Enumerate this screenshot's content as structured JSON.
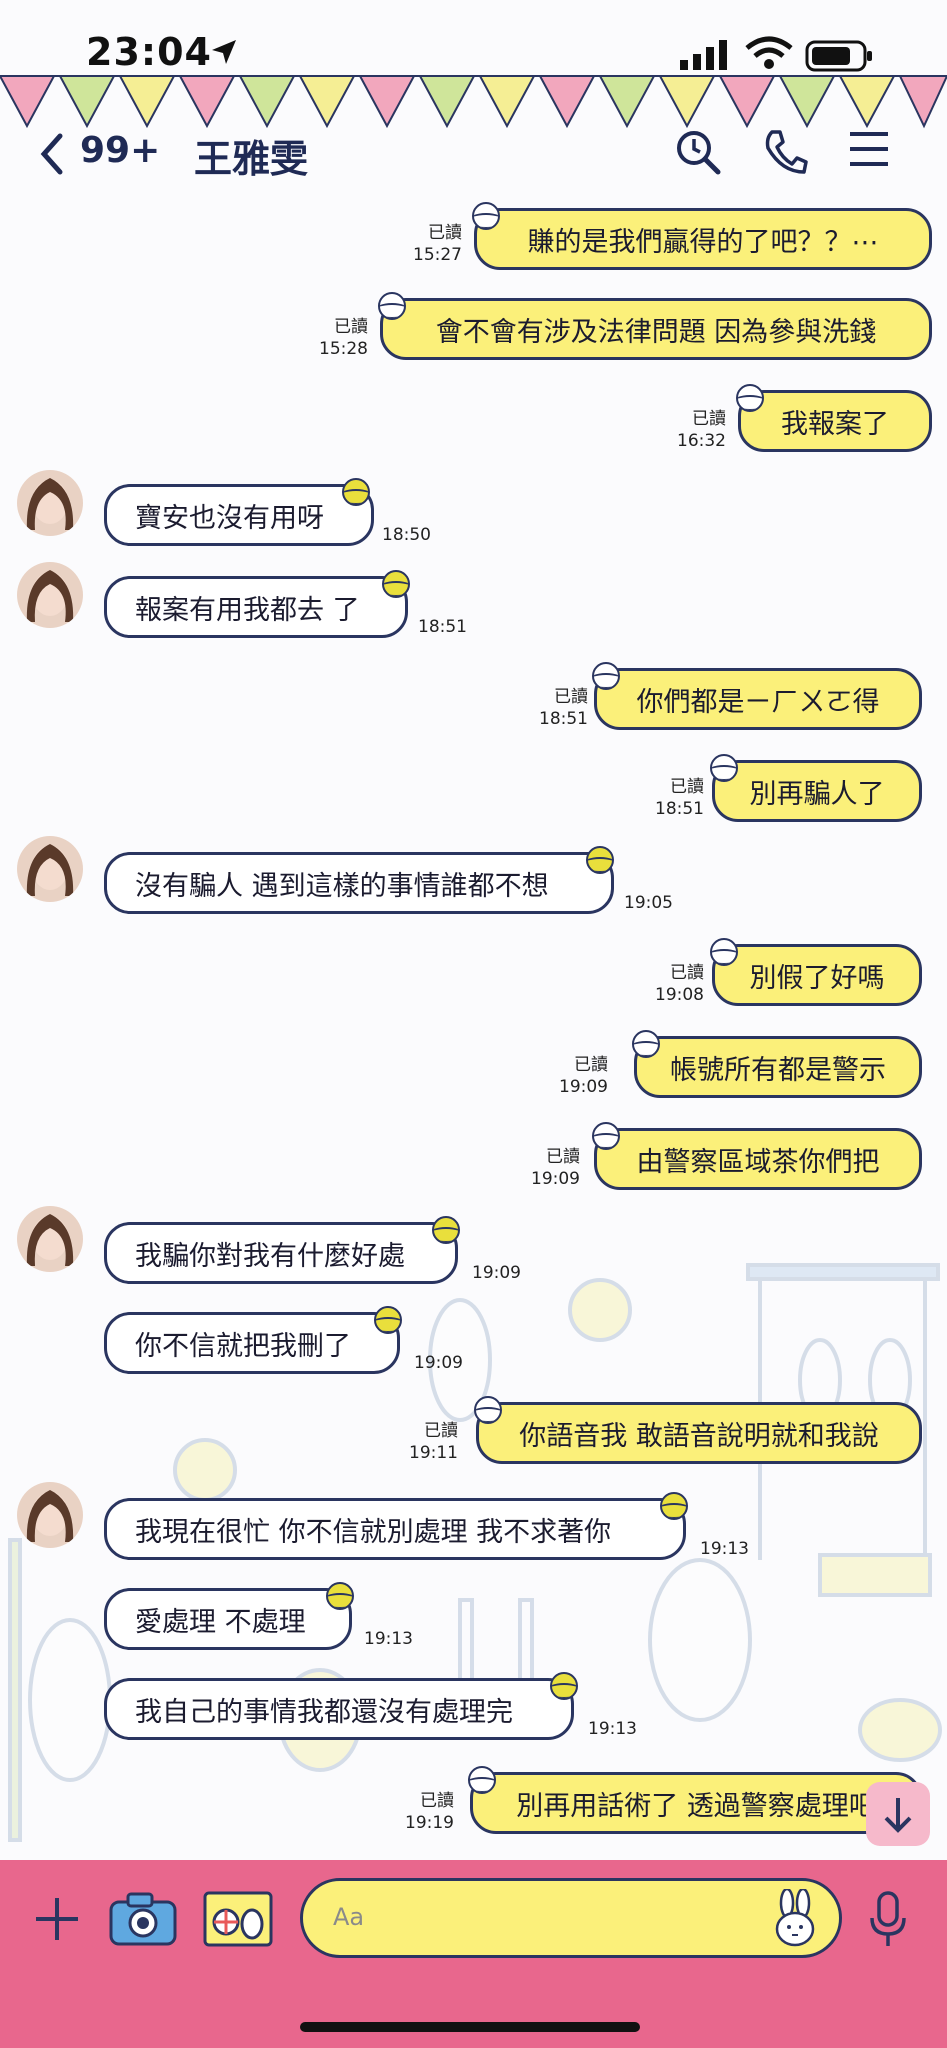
{
  "status_bar": {
    "time": "23:04",
    "icons": [
      "location-arrow-icon",
      "signal-icon",
      "wifi-icon",
      "battery-icon"
    ]
  },
  "header": {
    "unread_count": "99+",
    "contact_name": "王雅雯",
    "icons": [
      "back-chevron-icon",
      "search-clock-icon",
      "phone-icon",
      "menu-icon"
    ]
  },
  "read_label": "已讀",
  "messages": [
    {
      "dir": "out",
      "text": "賺的是我們贏得的了吧？？⋯",
      "time": "15:27",
      "read": "已讀"
    },
    {
      "dir": "out",
      "text": "會不會有涉及法律問題 因為參與洗錢",
      "time": "15:28",
      "read": "已讀"
    },
    {
      "dir": "out",
      "text": "我報案了",
      "time": "16:32",
      "read": "已讀"
    },
    {
      "dir": "in",
      "text": "寶安也沒有用呀",
      "time": "18:50"
    },
    {
      "dir": "in",
      "text": "報案有用我都去 了",
      "time": "18:51"
    },
    {
      "dir": "out",
      "text": "你們都是ㄧㄏㄨㄛ得",
      "time": "18:51",
      "read": "已讀"
    },
    {
      "dir": "out",
      "text": "別再騙人了",
      "time": "18:51",
      "read": "已讀"
    },
    {
      "dir": "in",
      "text": "沒有騙人 遇到這樣的事情誰都不想",
      "time": "19:05"
    },
    {
      "dir": "out",
      "text": "別假了好嗎",
      "time": "19:08",
      "read": "已讀"
    },
    {
      "dir": "out",
      "text": "帳號所有都是警示",
      "time": "19:09",
      "read": "已讀"
    },
    {
      "dir": "out",
      "text": "由警察區域茶你們把",
      "time": "19:09",
      "read": "已讀"
    },
    {
      "dir": "in",
      "text": "我騙你對我有什麼好處",
      "time": "19:09"
    },
    {
      "dir": "in",
      "text": "你不信就把我刪了",
      "time": "19:09"
    },
    {
      "dir": "out",
      "text": "你語音我 敢語音說明就和我說",
      "time": "19:11",
      "read": "已讀"
    },
    {
      "dir": "in",
      "text": "我現在很忙 你不信就別處理 我不求著你",
      "time": "19:13"
    },
    {
      "dir": "in",
      "text": "愛處理 不處理",
      "time": "19:13"
    },
    {
      "dir": "in",
      "text": "我自己的事情我都還沒有處理完",
      "time": "19:13"
    },
    {
      "dir": "out",
      "text": "別再用話術了 透過警察處理吧",
      "time": "19:19",
      "read": "已讀"
    }
  ],
  "input": {
    "placeholder": "Aa"
  },
  "bottom_icons": [
    "plus-icon",
    "camera-icon",
    "image-icon",
    "sticker-bunny-icon",
    "microphone-icon",
    "scroll-down-icon"
  ],
  "colors": {
    "bubble_out": "#fbf07a",
    "bubble_in": "#ffffff",
    "outline": "#2a3560",
    "input_bar": "#e8678d",
    "header_text": "#1f2a55"
  }
}
